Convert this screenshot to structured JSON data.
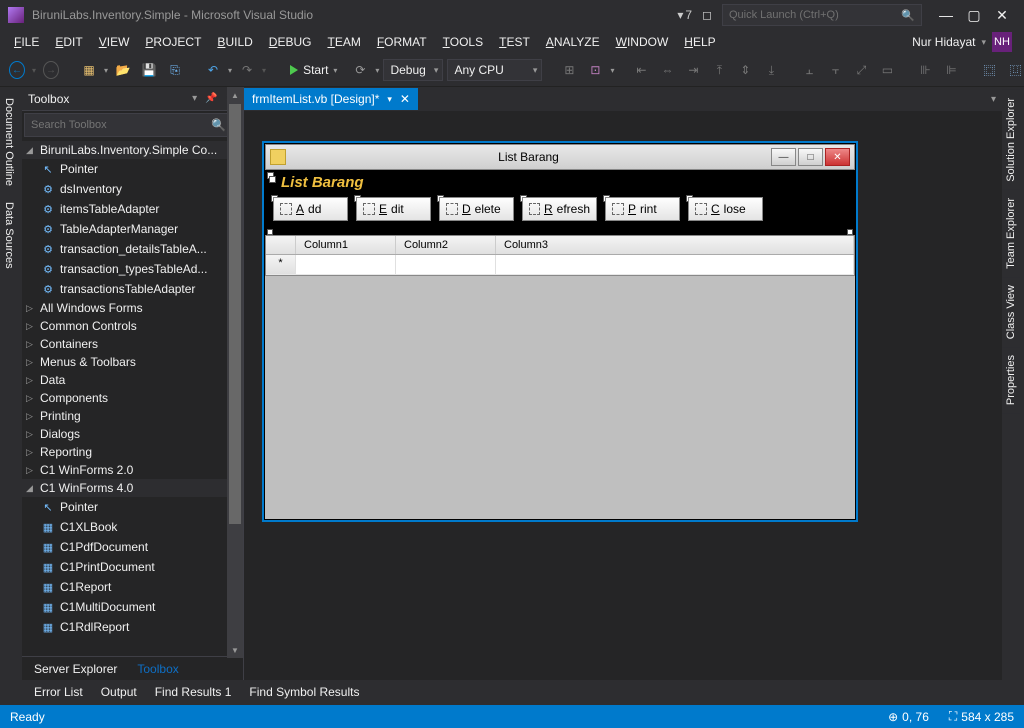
{
  "titlebar": {
    "app_title": "BiruniLabs.Inventory.Simple - Microsoft Visual Studio",
    "notif_count": "7",
    "quick_launch_placeholder": "Quick Launch (Ctrl+Q)"
  },
  "menubar": {
    "items": [
      "FILE",
      "EDIT",
      "VIEW",
      "PROJECT",
      "BUILD",
      "DEBUG",
      "TEAM",
      "FORMAT",
      "TOOLS",
      "TEST",
      "ANALYZE",
      "WINDOW",
      "HELP"
    ],
    "user_name": "Nur Hidayat",
    "user_initials": "NH"
  },
  "toolbar": {
    "start_label": "Start",
    "config_label": "Debug",
    "platform_label": "Any CPU"
  },
  "left_tabs": [
    "Document Outline",
    "Data Sources"
  ],
  "right_tabs": [
    "Solution Explorer",
    "Team Explorer",
    "Class View",
    "Properties"
  ],
  "toolbox": {
    "title": "Toolbox",
    "search_placeholder": "Search Toolbox",
    "root": "BiruniLabs.Inventory.Simple Co...",
    "comp_items": [
      "Pointer",
      "dsInventory",
      "itemsTableAdapter",
      "TableAdapterManager",
      "transaction_detailsTableA...",
      "transaction_typesTableAd...",
      "transactionsTableAdapter"
    ],
    "groups": [
      "All Windows Forms",
      "Common Controls",
      "Containers",
      "Menus & Toolbars",
      "Data",
      "Components",
      "Printing",
      "Dialogs",
      "Reporting",
      "C1 WinForms 2.0"
    ],
    "c1_group": "C1 WinForms 4.0",
    "c1_items": [
      "Pointer",
      "C1XLBook",
      "C1PdfDocument",
      "C1PrintDocument",
      "C1Report",
      "C1MultiDocument",
      "C1RdlReport"
    ],
    "bottom_tabs": [
      "Server Explorer",
      "Toolbox"
    ]
  },
  "doc_tab": "frmItemList.vb [Design]*",
  "form": {
    "window_title": "List Barang",
    "header_title": "List Barang",
    "buttons": [
      "Add",
      "Edit",
      "Delete",
      "Refresh",
      "Print",
      "Close"
    ],
    "columns": [
      "Column1",
      "Column2",
      "Column3"
    ],
    "row_marker": "*"
  },
  "status": {
    "ready": "Ready",
    "pos": "0, 76",
    "size": "584 x 285"
  },
  "bottom_tabs": [
    "Error List",
    "Output",
    "Find Results 1",
    "Find Symbol Results"
  ]
}
